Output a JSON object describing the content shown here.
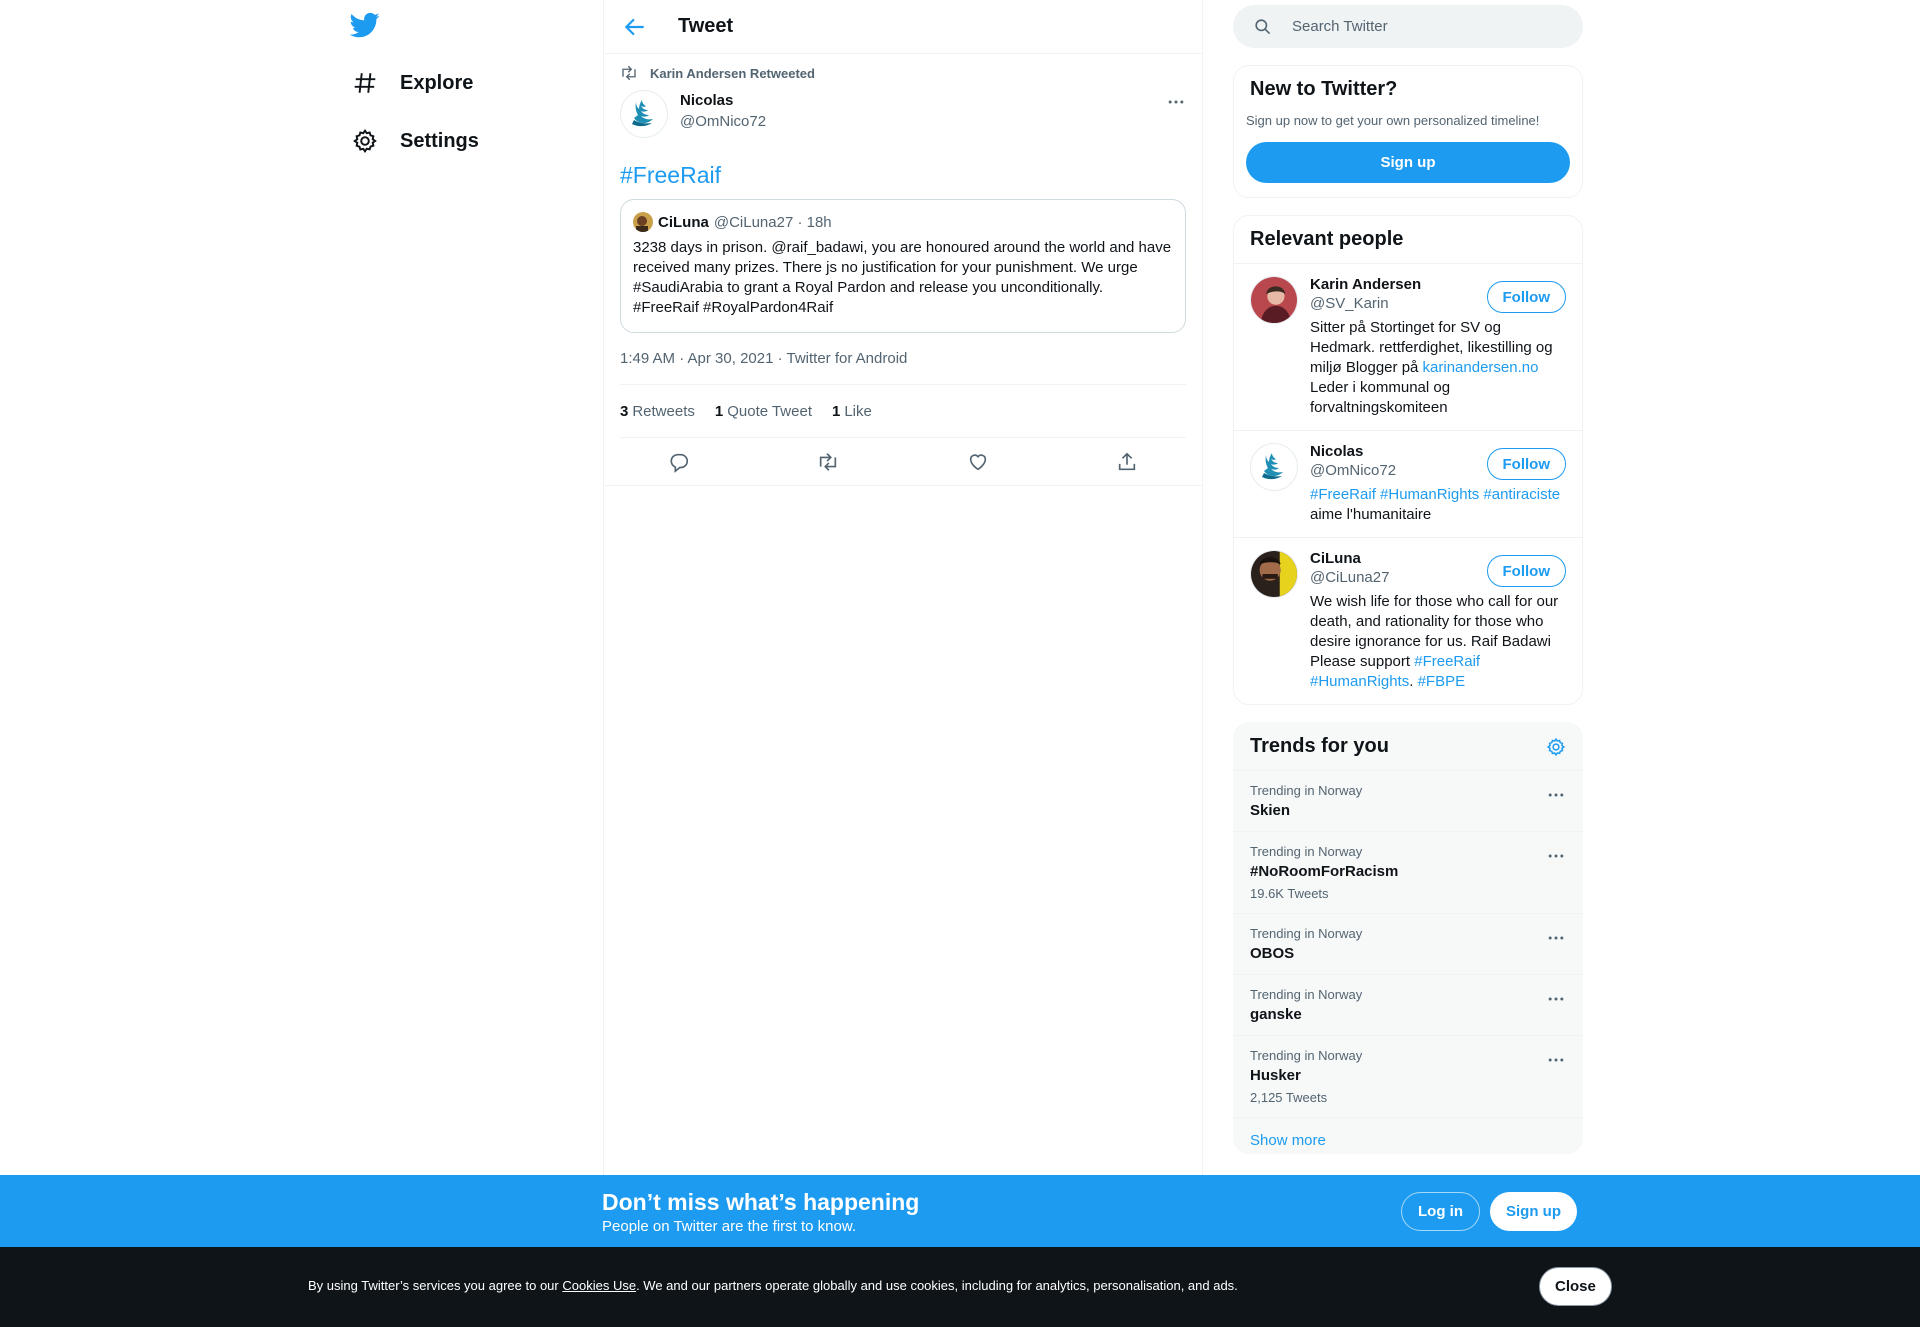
{
  "nav": {
    "logo_icon": "twitter-bird-icon",
    "items": [
      {
        "label": "Explore",
        "icon": "hashtag-icon"
      },
      {
        "label": "Settings",
        "icon": "gear-icon"
      }
    ]
  },
  "header": {
    "title": "Tweet"
  },
  "tweet": {
    "retweeted_by": "Karin Andersen Retweeted",
    "author_name": "Nicolas",
    "author_handle": "@OmNico72",
    "text": "#FreeRaif",
    "quote": {
      "name": "CiLuna",
      "handle_time": "@CiLuna27 · 18h",
      "text": "3238 days in prison. @raif_badawi, you are honoured around the world and have received many prizes. There js no justification for your punishment. We urge #SaudiArabia to grant a Royal Pardon and release you unconditionally. #FreeRaif #RoyalPardon4Raif"
    },
    "meta": "1:49 AM · Apr 30, 2021 · Twitter for Android",
    "stats": {
      "retweets_count": "3",
      "retweets_label": "Retweets",
      "quotes_count": "1",
      "quotes_label": "Quote Tweet",
      "likes_count": "1",
      "likes_label": "Like"
    }
  },
  "search": {
    "placeholder": "Search Twitter"
  },
  "new_to_twitter": {
    "title": "New to Twitter?",
    "subtitle": "Sign up now to get your own personalized timeline!",
    "button": "Sign up"
  },
  "relevant": {
    "title": "Relevant people",
    "follow_label": "Follow",
    "people": [
      {
        "name": "Karin Andersen",
        "handle": "@SV_Karin",
        "bio_pre": "Sitter på Stortinget for SV og Hedmark. rettferdighet, likestilling og miljø Blogger på ",
        "bio_link": "karinandersen.no",
        "bio_post": " Leder i kommunal og forvaltningskomiteen"
      },
      {
        "name": "Nicolas",
        "handle": "@OmNico72",
        "bio_tags": "#FreeRaif #HumanRights #antiraciste",
        "bio_post": " aime l'humanitaire"
      },
      {
        "name": "CiLuna",
        "handle": "@CiLuna27",
        "bio_pre": "We wish life for those who call for our death, and rationality for those who desire ignorance for us. Raif Badawi Please support ",
        "bio_tag1": "#FreeRaif",
        "bio_tag2": "#HumanRights",
        "bio_mid": ". ",
        "bio_tag3": "#FBPE"
      }
    ]
  },
  "trends": {
    "title": "Trends for you",
    "items": [
      {
        "context": "Trending in Norway",
        "name": "Skien",
        "count": ""
      },
      {
        "context": "Trending in Norway",
        "name": "#NoRoomForRacism",
        "count": "19.6K Tweets"
      },
      {
        "context": "Trending in Norway",
        "name": "OBOS",
        "count": ""
      },
      {
        "context": "Trending in Norway",
        "name": "ganske",
        "count": ""
      },
      {
        "context": "Trending in Norway",
        "name": "Husker",
        "count": "2,125 Tweets"
      }
    ],
    "show_more": "Show more"
  },
  "bottom_bar": {
    "title": "Don’t miss what’s happening",
    "subtitle": "People on Twitter are the first to know.",
    "login": "Log in",
    "signup": "Sign up"
  },
  "cookie": {
    "pre": "By using Twitter’s services you agree to our ",
    "link": "Cookies Use",
    "post": ". We and our partners operate globally and use cookies, including for analytics, personalisation, and ads.",
    "close": "Close"
  },
  "colors": {
    "accent": "#1d9bf0",
    "text": "#0f1419",
    "muted": "#536471",
    "cookie_bg": "#0f1419"
  }
}
